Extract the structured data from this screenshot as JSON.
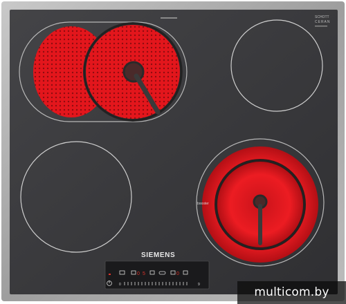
{
  "product": {
    "brand": "SIEMENS",
    "glass_logo": [
      "SCHOTT",
      "CERAN"
    ],
    "zone_labels": [
      "booster"
    ]
  },
  "cooking_zones": [
    {
      "position": "rear-left",
      "type": "dual-oval extended zone",
      "state": "glowing"
    },
    {
      "position": "rear-right",
      "type": "single round zone",
      "state": "off"
    },
    {
      "position": "front-left",
      "type": "single round zone",
      "state": "off"
    },
    {
      "position": "front-right",
      "type": "dual-circuit zone",
      "state": "glowing"
    }
  ],
  "control_panel": {
    "digits": [
      "0",
      "5",
      "0"
    ],
    "slider_scale_start": "0",
    "slider_scale_end": "9"
  },
  "watermark": "multicom.by",
  "colors": {
    "frame": "#a9a9a9",
    "glass": "#3b3b3e",
    "glow": "#e4161c",
    "panel_text": "#e0332a"
  }
}
